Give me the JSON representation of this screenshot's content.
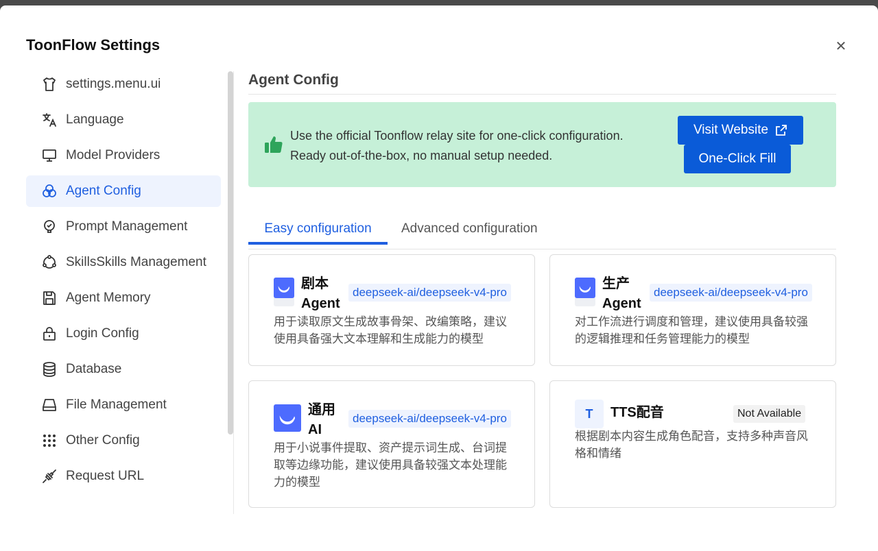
{
  "dialog": {
    "title": "ToonFlow Settings"
  },
  "sidebar": {
    "items": [
      {
        "label": "settings.menu.ui",
        "icon": "shirt-icon"
      },
      {
        "label": "Language",
        "icon": "translate-icon"
      },
      {
        "label": "Model Providers",
        "icon": "monitor-icon"
      },
      {
        "label": "Agent Config",
        "icon": "circles-icon"
      },
      {
        "label": "Prompt Management",
        "icon": "bulb-icon"
      },
      {
        "label": "SkillsSkills Management",
        "icon": "nodes-icon"
      },
      {
        "label": "Agent Memory",
        "icon": "save-icon"
      },
      {
        "label": "Login Config",
        "icon": "lock-icon"
      },
      {
        "label": "Database",
        "icon": "database-icon"
      },
      {
        "label": "File Management",
        "icon": "drive-icon"
      },
      {
        "label": "Other Config",
        "icon": "grid-dots-icon"
      },
      {
        "label": "Request URL",
        "icon": "plug-icon"
      }
    ],
    "active_index": 3
  },
  "main": {
    "section_title": "Agent Config",
    "banner": {
      "line1": "Use the official Toonflow relay site for one-click configuration.",
      "line2": "Ready out-of-the-box, no manual setup needed.",
      "visit_label": "Visit Website",
      "fill_label": "One-Click Fill"
    },
    "tabs": [
      {
        "label": "Easy configuration",
        "active": true
      },
      {
        "label": "Advanced configuration",
        "active": false
      }
    ],
    "cards": [
      {
        "name_line1": "剧本",
        "name_line2": "Agent",
        "model": "deepseek-ai/deepseek-v4-pro",
        "desc": "用于读取原文生成故事骨架、改编策略，建议使用具备强大文本理解和生成能力的模型"
      },
      {
        "name_line1": "生产",
        "name_line2": "Agent",
        "model": "deepseek-ai/deepseek-v4-pro",
        "desc": "对工作流进行调度和管理，建议使用具备较强的逻辑推理和任务管理能力的模型"
      },
      {
        "name_line1": "通用",
        "name_line2": "AI",
        "model": "deepseek-ai/deepseek-v4-pro",
        "desc": "用于小说事件提取、资产提示词生成、台词提取等边缘功能，建议使用具备较强文本处理能力的模型"
      },
      {
        "name": "TTS配音",
        "logo_letter": "T",
        "status": "Not Available",
        "desc": "根据剧本内容生成角色配音，支持多种声音风格和情绪"
      }
    ]
  },
  "colors": {
    "accent": "#1f5fe0",
    "button": "#0a5bd8",
    "banner_bg": "#c6f0d8",
    "thumb_green": "#2ea45b",
    "deepseek_blue": "#4d6bfe"
  }
}
